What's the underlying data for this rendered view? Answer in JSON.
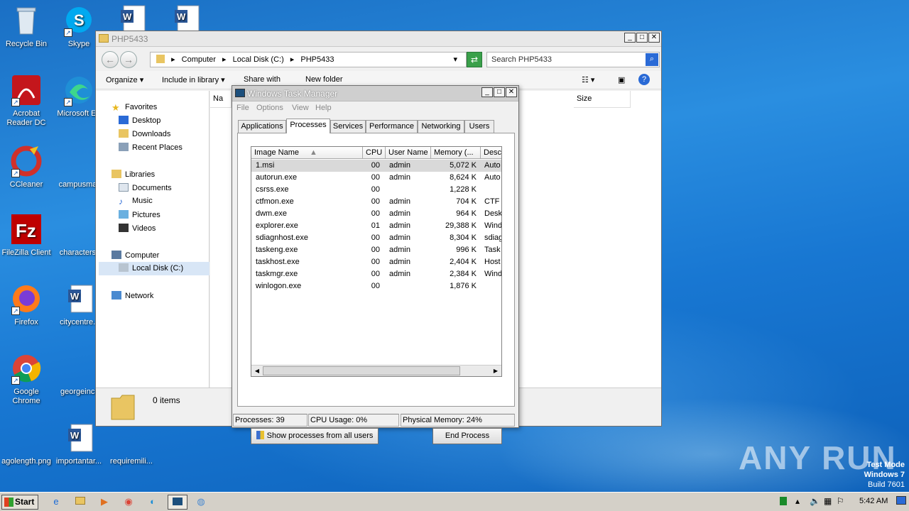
{
  "desktop": {
    "icons": [
      {
        "label": "Recycle Bin"
      },
      {
        "label": "Skype"
      },
      {
        "label": "Acrobat Reader DC"
      },
      {
        "label": "Microsoft Ed"
      },
      {
        "label": "CCleaner"
      },
      {
        "label": "campusmat"
      },
      {
        "label": "FileZilla Client"
      },
      {
        "label": "characterst"
      },
      {
        "label": "Firefox"
      },
      {
        "label": "citycentre.r"
      },
      {
        "label": "Google Chrome"
      },
      {
        "label": "georgeincr"
      },
      {
        "label": "agolength.png"
      },
      {
        "label": "importantar..."
      },
      {
        "label": "requiremili..."
      }
    ]
  },
  "explorer": {
    "title": "PHP5433",
    "address": [
      "Computer",
      "Local Disk (C:)",
      "PHP5433"
    ],
    "search_placeholder": "Search PHP5433",
    "toolbar": {
      "organize": "Organize",
      "include": "Include in library",
      "share": "Share with",
      "newfolder": "New folder"
    },
    "nav": {
      "favorites": "Favorites",
      "desktop": "Desktop",
      "downloads": "Downloads",
      "recent": "Recent Places",
      "libraries": "Libraries",
      "documents": "Documents",
      "music": "Music",
      "pictures": "Pictures",
      "videos": "Videos",
      "computer": "Computer",
      "localdisk": "Local Disk (C:)",
      "network": "Network"
    },
    "columns": {
      "name": "Na",
      "size": "Size"
    },
    "status": "0 items"
  },
  "taskmgr": {
    "title": "Windows Task Manager",
    "menu": [
      "File",
      "Options",
      "View",
      "Help"
    ],
    "tabs": [
      "Applications",
      "Processes",
      "Services",
      "Performance",
      "Networking",
      "Users"
    ],
    "active_tab": "Processes",
    "columns": [
      "Image Name",
      "CPU",
      "User Name",
      "Memory (...",
      "Desc"
    ],
    "processes": [
      {
        "name": "1.msi",
        "cpu": "00",
        "user": "admin",
        "mem": "5,072 K",
        "desc": "Auto"
      },
      {
        "name": "autorun.exe",
        "cpu": "00",
        "user": "admin",
        "mem": "8,624 K",
        "desc": "Auto"
      },
      {
        "name": "csrss.exe",
        "cpu": "00",
        "user": "",
        "mem": "1,228 K",
        "desc": ""
      },
      {
        "name": "ctfmon.exe",
        "cpu": "00",
        "user": "admin",
        "mem": "704 K",
        "desc": "CTF I"
      },
      {
        "name": "dwm.exe",
        "cpu": "00",
        "user": "admin",
        "mem": "964 K",
        "desc": "Desk"
      },
      {
        "name": "explorer.exe",
        "cpu": "01",
        "user": "admin",
        "mem": "29,388 K",
        "desc": "Wind"
      },
      {
        "name": "sdiagnhost.exe",
        "cpu": "00",
        "user": "admin",
        "mem": "8,304 K",
        "desc": "sdiag"
      },
      {
        "name": "taskeng.exe",
        "cpu": "00",
        "user": "admin",
        "mem": "996 K",
        "desc": "Task"
      },
      {
        "name": "taskhost.exe",
        "cpu": "00",
        "user": "admin",
        "mem": "2,404 K",
        "desc": "Host"
      },
      {
        "name": "taskmgr.exe",
        "cpu": "00",
        "user": "admin",
        "mem": "2,384 K",
        "desc": "Wind"
      },
      {
        "name": "winlogon.exe",
        "cpu": "00",
        "user": "",
        "mem": "1,876 K",
        "desc": ""
      }
    ],
    "show_all_label": "Show processes from all users",
    "end_process_label": "End Process",
    "status": {
      "processes": "Processes: 39",
      "cpu": "CPU Usage: 0%",
      "memory": "Physical Memory: 24%"
    }
  },
  "taskbar": {
    "start_label": "Start",
    "clock": "5:42 AM"
  },
  "watermark": {
    "brand": "ANY RUN",
    "testmode_line1": "Test Mode",
    "testmode_line2": "Windows 7",
    "testmode_line3": "Build 7601"
  }
}
